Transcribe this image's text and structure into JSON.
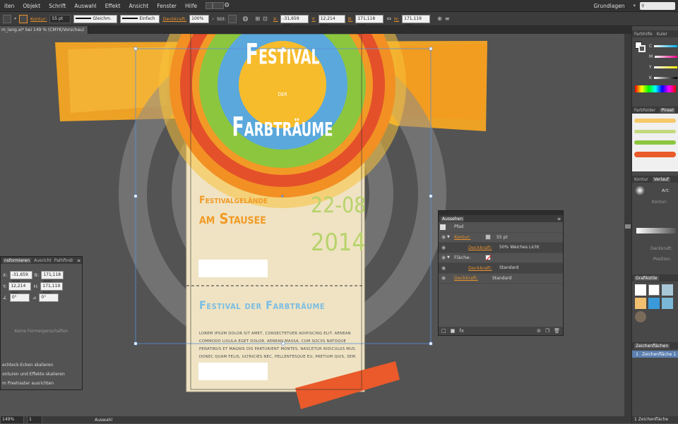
{
  "menu": [
    "iten",
    "Objekt",
    "Schrift",
    "Auswahl",
    "Effekt",
    "Ansicht",
    "Fenster",
    "Hilfe"
  ],
  "workspace": "Grundlagen",
  "control": {
    "kontur_label": "Kontur:",
    "kontur_value": "55 pt",
    "stroke_profile": "Gleichm.",
    "brush": "Einfach",
    "deckkraft_label": "Deckkraft:",
    "deckkraft_value": "100%",
    "stil_label": "Stil:",
    "x_label": "X:",
    "x_value": "-31,659 mm",
    "y_label": "Y:",
    "y_value": "12,214 mm",
    "b_label": "B:",
    "b_value": "171,118 mm",
    "h_label": "H:",
    "h_value": "171,119 mm"
  },
  "document_tab": "m_lang.ai* bei 149 % (CMYK/Vorschau)",
  "poster": {
    "title_line1": "Festival",
    "title_line2": "der",
    "title_line3": "Farbträume",
    "venue_line1": "Festivalgelände",
    "venue_line2": "am Stausee",
    "date_line1": "22-08",
    "date_line2": "2014",
    "ticket_title": "Festival der Farbträume",
    "lorem": "Lorem ipsum dolor sit amet, consectetuer adipiscing elit. Aenean commodo ligula eget dolor. Aenean massa. Cum sociis natoque penatibus et magnis dis parturient montes, nascetur ridiculus mus. Donec quam felis, ultricies nec, pellentesque eu, pretium quis, sem."
  },
  "appearance_panel": {
    "title": "Aussehen",
    "object": "Pfad",
    "kontur_label": "Kontur:",
    "kontur_value": "55 pt",
    "deckkraft1_label": "Deckkraft:",
    "deckkraft1_value": "50% Weiches Licht",
    "flaeche_label": "Fläche:",
    "deckkraft2_label": "Deckkraft:",
    "deckkraft2_value": "Standard",
    "deckkraft3_label": "Deckkraft:",
    "deckkraft3_value": "Standard"
  },
  "transform_panel": {
    "tabs": [
      "nsformieren",
      "Ausricht",
      "Pathfindr"
    ],
    "x_label": "X:",
    "x_value": "-31,659 mm",
    "b_label": "B:",
    "b_value": "171,118 mm",
    "y_label": "Y:",
    "y_value": "12,214 mm",
    "h_label": "H:",
    "h_value": "171,119 mm",
    "angle1": "0°",
    "angle2": "0°",
    "no_shape": "Keine Formeigenschaften",
    "opt1": "echteck-Ecken skalieren",
    "opt2": "onturen und Effekte skalieren",
    "opt3": "m Pixelraster ausrichten"
  },
  "right_dock": {
    "color_tabs": [
      "Farbhilfe",
      "Kuler"
    ],
    "cmyk": [
      "C",
      "M",
      "Y",
      "K"
    ],
    "brush_tabs": [
      "Farbfelder",
      "Pinsel"
    ],
    "stroke_tabs": [
      "Kontur",
      "Verlauf"
    ],
    "art_label": "Art:",
    "kontur_label": "Kontur:",
    "deckkraft_label": "Deckkraft:",
    "position_label": "Position:",
    "graphic_styles": "Grafikstile",
    "artboards": "Zeichenflächen",
    "artboard_item_num": "1",
    "artboard_item_name": "Zeichenfläche 1",
    "artboard_count": "1 Zeichenfläche"
  },
  "status": {
    "zoom": "149%",
    "page": "1",
    "tool": "Auswahl"
  },
  "colors": {
    "accent": "#e8912b",
    "blue": "#5aa8dc",
    "green": "#8cc63e",
    "orange": "#f39a1e",
    "red": "#e44e2a",
    "cream": "#efe3c3",
    "ticket_blue": "#6ab4e0"
  }
}
